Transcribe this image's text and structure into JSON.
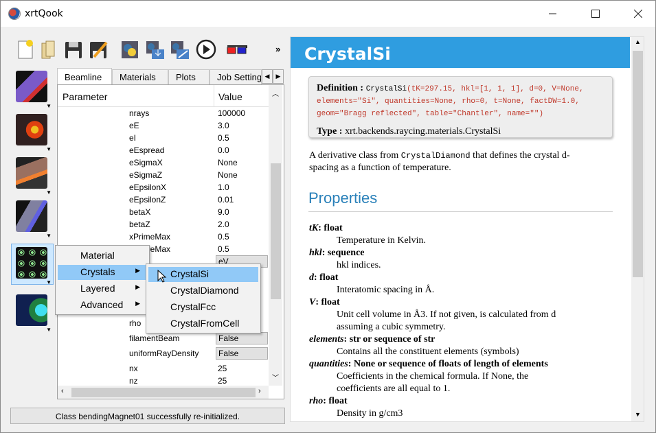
{
  "window": {
    "title": "xrtQook"
  },
  "tabs": [
    "Beamline",
    "Materials",
    "Plots",
    "Job Settings"
  ],
  "table": {
    "headers": [
      "Parameter",
      "Value"
    ],
    "rows": [
      {
        "p": "nrays",
        "v": "100000"
      },
      {
        "p": "eE",
        "v": "3.0"
      },
      {
        "p": "eI",
        "v": "0.5"
      },
      {
        "p": "eEspread",
        "v": "0.0"
      },
      {
        "p": "eSigmaX",
        "v": "None"
      },
      {
        "p": "eSigmaZ",
        "v": "None"
      },
      {
        "p": "eEpsilonX",
        "v": "1.0"
      },
      {
        "p": "eEpsilonZ",
        "v": "0.01"
      },
      {
        "p": "betaX",
        "v": "9.0"
      },
      {
        "p": "betaZ",
        "v": "2.0"
      },
      {
        "p": "xPrimeMax",
        "v": "0.5"
      },
      {
        "p": "zPrimeMax",
        "v": "0.5"
      },
      {
        "p": "",
        "v": "eV"
      },
      {
        "p": "",
        "v": ""
      },
      {
        "p": "",
        "v": ""
      },
      {
        "p": "",
        "v": ""
      },
      {
        "p": "",
        "v": ""
      },
      {
        "p": "rho",
        "v": ""
      },
      {
        "p": "filamentBeam",
        "v": "False"
      },
      {
        "p": "uniformRayDensity",
        "v": "False"
      },
      {
        "p": "nx",
        "v": "25"
      },
      {
        "p": "nz",
        "v": "25"
      }
    ]
  },
  "status": "Class bendingMagnet01 successfully re-initialized.",
  "menu": {
    "items": [
      "Material",
      "Crystals",
      "Layered",
      "Advanced"
    ],
    "submenu": [
      "CrystalSi",
      "CrystalDiamond",
      "CrystalFcc",
      "CrystalFromCell"
    ]
  },
  "doc": {
    "title": "CrystalSi",
    "def_label": "Definition :",
    "def_name": "CrystalSi",
    "def_args_1": "(tK=297.15, hkl=[1, 1, 1], d=0, V=None,",
    "def_args_2": "elements=\"Si\", quantities=None, rho=0, t=None, factDW=1.0,",
    "def_args_3": "geom=\"Bragg reflected\", table=\"Chantler\", name=\"\")",
    "type_label": "Type :",
    "type_value": "xrt.backends.raycing.materials.CrystalSi",
    "desc_1": "A derivative class from",
    "desc_code": "CrystalDiamond",
    "desc_2": "that defines the crystal d-",
    "desc_3": "spacing as a function of temperature.",
    "properties_title": "Properties",
    "props": [
      {
        "name": "tK",
        "type": ": float",
        "desc": "Temperature in Kelvin."
      },
      {
        "name": "hkl",
        "type": ": sequence",
        "desc": "hkl indices."
      },
      {
        "name": "d",
        "type": ": float",
        "desc": "Interatomic spacing in Å."
      },
      {
        "name": "V",
        "type": ": float",
        "desc": "Unit cell volume in Å3. If not given, is calculated from d",
        "desc2": "assuming a cubic symmetry."
      },
      {
        "name": "elements",
        "type": ": str or sequence of str",
        "desc": "Contains all the constituent elements (symbols)"
      },
      {
        "name": "quantities",
        "type": ": None or sequence of floats of length of elements",
        "desc": "Coefficients in the chemical formula. If None, the",
        "desc2": "coefficients are all equal to 1."
      },
      {
        "name": "rho",
        "type": ": float",
        "desc": "Density in g/cm3"
      }
    ]
  }
}
